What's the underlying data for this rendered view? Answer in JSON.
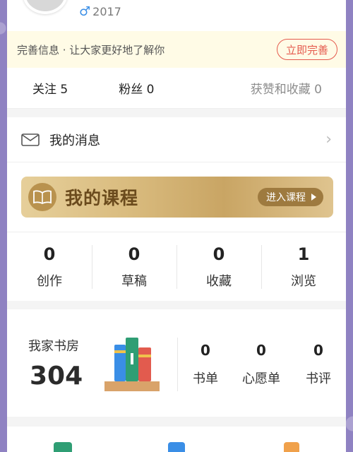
{
  "profile": {
    "year": "2017",
    "gender_icon": "male-icon"
  },
  "notice": {
    "text": "完善信息 · 让大家更好地了解你",
    "button": "立即完善"
  },
  "social": {
    "follow": "关注 5",
    "fans": "粉丝 0",
    "likes": "获赞和收藏 0"
  },
  "messages": {
    "label": "我的消息"
  },
  "course": {
    "title": "我的课程",
    "enter": "进入课程"
  },
  "counters": [
    {
      "value": "0",
      "label": "创作"
    },
    {
      "value": "0",
      "label": "草稿"
    },
    {
      "value": "0",
      "label": "收藏"
    },
    {
      "value": "1",
      "label": "浏览"
    }
  ],
  "study": {
    "title": "我家书房",
    "count": "304",
    "stats": [
      {
        "value": "0",
        "label": "书单"
      },
      {
        "value": "0",
        "label": "心愿单"
      },
      {
        "value": "0",
        "label": "书评"
      }
    ]
  },
  "colors": {
    "accent_red": "#e55a4d",
    "gold": "#c9a564",
    "notice_bg": "#fffbe6"
  }
}
